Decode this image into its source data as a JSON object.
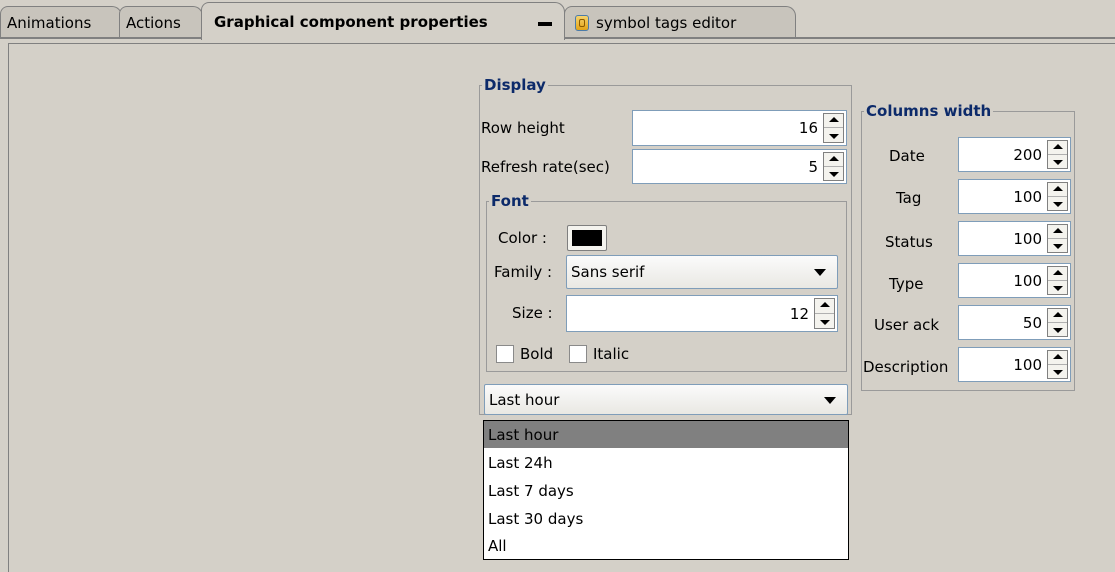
{
  "tabs": [
    {
      "label": "Animations"
    },
    {
      "label": "Actions"
    },
    {
      "label": "Graphical component properties"
    },
    {
      "label": "symbol tags editor",
      "icon": "database-icon"
    }
  ],
  "display": {
    "title": "Display",
    "row_height_label": "Row height",
    "row_height_value": "16",
    "refresh_rate_label": "Refresh rate(sec)",
    "refresh_rate_value": "5"
  },
  "font": {
    "title": "Font",
    "color_label": "Color :",
    "color_value": "#000000",
    "family_label": "Family :",
    "family_value": "Sans serif",
    "size_label": "Size :",
    "size_value": "12",
    "bold_label": "Bold",
    "italic_label": "Italic"
  },
  "time_range": {
    "selected": "Last hour",
    "options": [
      "Last hour",
      "Last 24h",
      "Last 7 days",
      "Last 30 days",
      "All"
    ]
  },
  "columns_width": {
    "title": "Columns width",
    "rows": [
      {
        "label": "Date",
        "value": "200"
      },
      {
        "label": "Tag",
        "value": "100"
      },
      {
        "label": "Status",
        "value": "100"
      },
      {
        "label": "Type",
        "value": "100"
      },
      {
        "label": "User ack",
        "value": "50"
      },
      {
        "label": "Description",
        "value": "100"
      }
    ]
  }
}
